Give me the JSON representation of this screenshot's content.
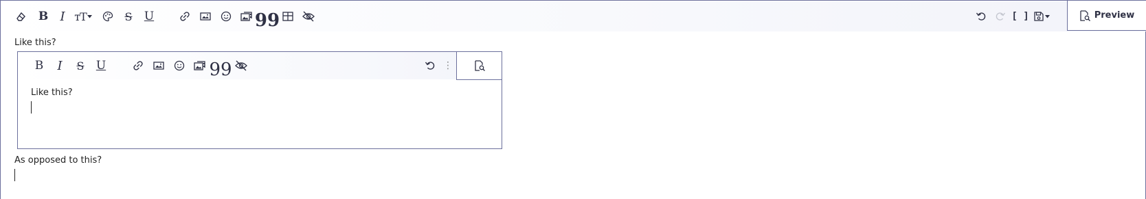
{
  "toolbar": {
    "left_buttons": [
      {
        "name": "clear-format-icon"
      },
      {
        "name": "bold-icon",
        "glyph": "B"
      },
      {
        "name": "italic-icon",
        "glyph": "I"
      },
      {
        "name": "text-size-icon",
        "glyph": "тT"
      },
      {
        "name": "palette-icon"
      },
      {
        "name": "strikethrough-icon",
        "glyph": "S"
      },
      {
        "name": "underline-icon",
        "glyph": "U"
      },
      {
        "name": "link-icon"
      },
      {
        "name": "image-icon"
      },
      {
        "name": "smiley-icon"
      },
      {
        "name": "media-icon"
      },
      {
        "name": "quote-icon",
        "glyph": "99"
      },
      {
        "name": "table-icon"
      },
      {
        "name": "spoiler-icon"
      }
    ],
    "right_buttons": [
      {
        "name": "undo-icon"
      },
      {
        "name": "redo-icon",
        "disabled": true
      },
      {
        "name": "toggle-bbcode-icon",
        "glyph": "[ ]"
      },
      {
        "name": "drafts-icon"
      }
    ],
    "preview_label": "Preview"
  },
  "content": {
    "line1": "Like this?",
    "line2": "As opposed to this?"
  },
  "nested_editor": {
    "content_line": "Like this?",
    "more_glyph": "⋮"
  }
}
